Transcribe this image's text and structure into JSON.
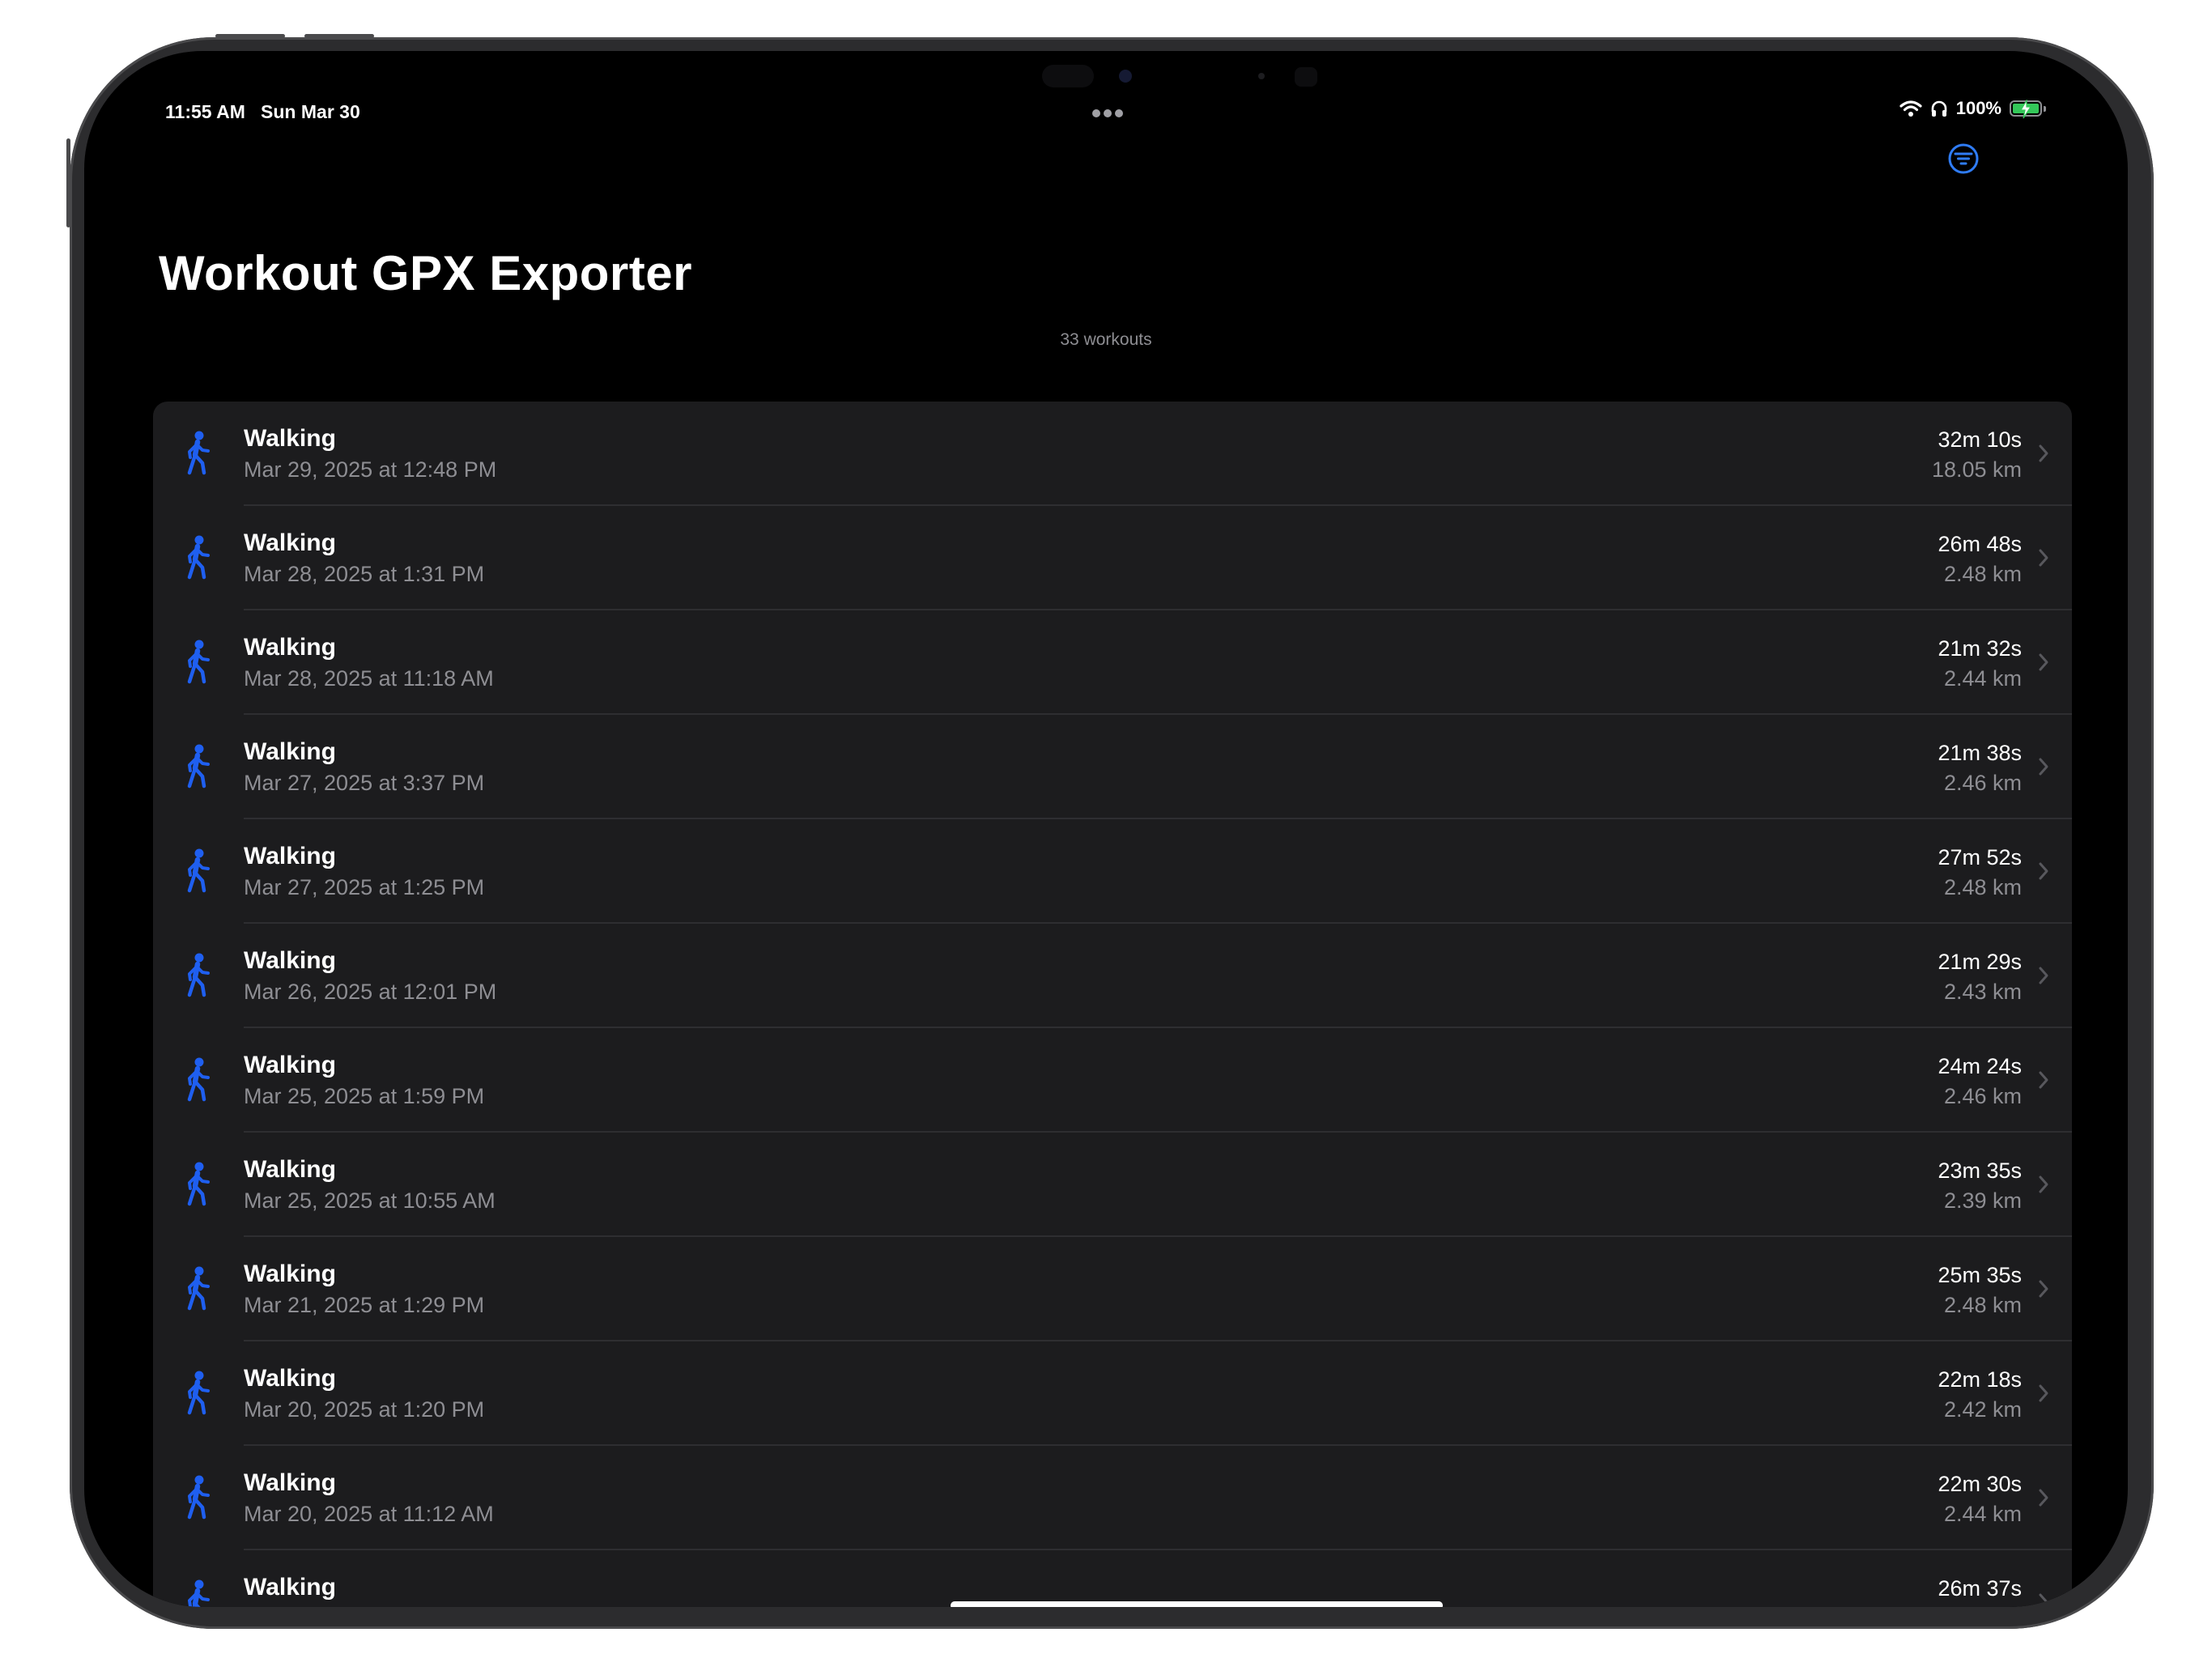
{
  "status_bar": {
    "time": "11:55 AM",
    "date": "Sun Mar 30",
    "battery_percent": "100%",
    "battery_level": 1.0,
    "charging": true
  },
  "header": {
    "title": "Workout GPX Exporter",
    "workout_count": "33 workouts",
    "filter_icon": "line-3-horizontal-decrease-circle-icon"
  },
  "colors": {
    "accent": "#2f7cf6",
    "walk_icon": "#1f5ff0",
    "background": "#000000",
    "card": "#1c1c1e",
    "secondary_text": "#8e8e93",
    "battery_green": "#34c759"
  },
  "workouts": [
    {
      "type": "Walking",
      "date": "Mar 29, 2025 at 12:48 PM",
      "duration": "32m 10s",
      "distance": "18.05 km"
    },
    {
      "type": "Walking",
      "date": "Mar 28, 2025 at 1:31 PM",
      "duration": "26m 48s",
      "distance": "2.48 km"
    },
    {
      "type": "Walking",
      "date": "Mar 28, 2025 at 11:18 AM",
      "duration": "21m 32s",
      "distance": "2.44 km"
    },
    {
      "type": "Walking",
      "date": "Mar 27, 2025 at 3:37 PM",
      "duration": "21m 38s",
      "distance": "2.46 km"
    },
    {
      "type": "Walking",
      "date": "Mar 27, 2025 at 1:25 PM",
      "duration": "27m 52s",
      "distance": "2.48 km"
    },
    {
      "type": "Walking",
      "date": "Mar 26, 2025 at 12:01 PM",
      "duration": "21m 29s",
      "distance": "2.43 km"
    },
    {
      "type": "Walking",
      "date": "Mar 25, 2025 at 1:59 PM",
      "duration": "24m 24s",
      "distance": "2.46 km"
    },
    {
      "type": "Walking",
      "date": "Mar 25, 2025 at 10:55 AM",
      "duration": "23m 35s",
      "distance": "2.39 km"
    },
    {
      "type": "Walking",
      "date": "Mar 21, 2025 at 1:29 PM",
      "duration": "25m 35s",
      "distance": "2.48 km"
    },
    {
      "type": "Walking",
      "date": "Mar 20, 2025 at 1:20 PM",
      "duration": "22m 18s",
      "distance": "2.42 km"
    },
    {
      "type": "Walking",
      "date": "Mar 20, 2025 at 11:12 AM",
      "duration": "22m 30s",
      "distance": "2.44 km"
    },
    {
      "type": "Walking",
      "date": "",
      "duration": "26m 37s",
      "distance": ""
    }
  ]
}
